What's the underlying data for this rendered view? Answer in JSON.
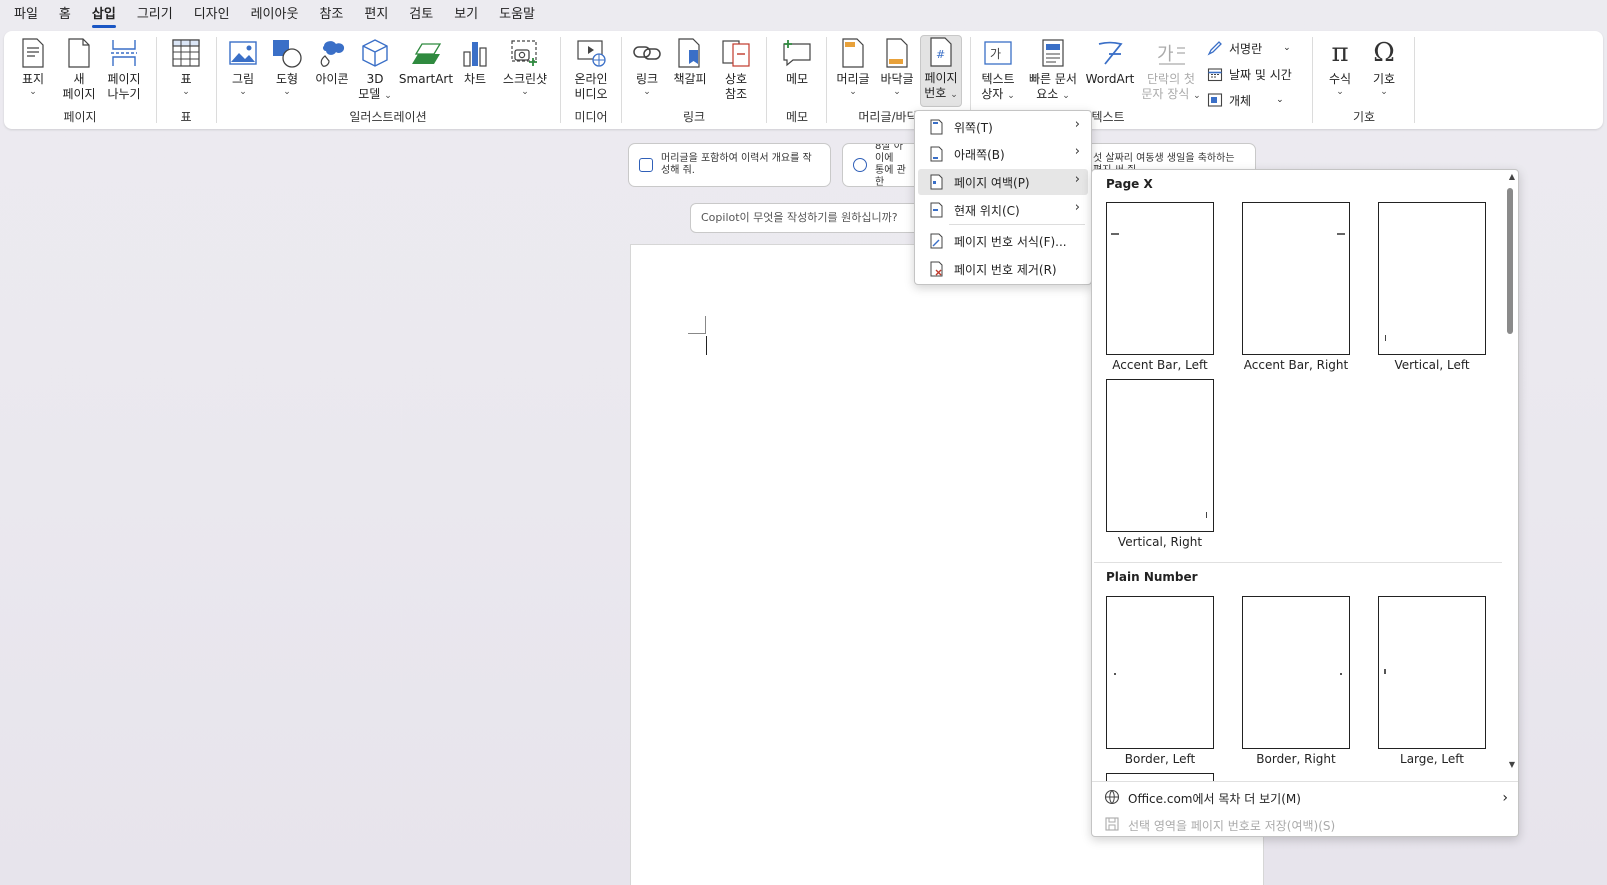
{
  "menu": {
    "items": [
      "파일",
      "홈",
      "삽입",
      "그리기",
      "디자인",
      "레이아웃",
      "참조",
      "편지",
      "검토",
      "보기",
      "도움말"
    ],
    "active_index": 2
  },
  "ribbon": {
    "groups": {
      "pages": "페이지",
      "table": "표",
      "illustrations": "일러스트레이션",
      "media": "미디어",
      "links": "링크",
      "comments": "메모",
      "header_footer": "머리글/바닥",
      "text": "텍스트",
      "symbols": "기호"
    },
    "buttons": {
      "cover": "표지",
      "new_page_1": "새",
      "new_page_2": "페이지",
      "page_break_1": "페이지",
      "page_break_2": "나누기",
      "table": "표",
      "pictures": "그림",
      "shapes": "도형",
      "icons": "아이콘",
      "model3d_1": "3D",
      "model3d_2": "모델",
      "smartart": "SmartArt",
      "chart": "차트",
      "screenshot": "스크린샷",
      "online_video_1": "온라인",
      "online_video_2": "비디오",
      "link": "링크",
      "bookmark": "책갈피",
      "crossref_1": "상호",
      "crossref_2": "참조",
      "comment": "메모",
      "header": "머리글",
      "footer": "바닥글",
      "page_number_1": "페이지",
      "page_number_2": "번호",
      "textbox_1": "텍스트",
      "textbox_2": "상자",
      "quickparts_1": "빠른 문서",
      "quickparts_2": "요소",
      "wordart": "WordArt",
      "dropcap_1": "단락의 첫",
      "dropcap_2": "문자 장식",
      "signature": "서명란",
      "datetime": "날짜 및 시간",
      "object": "개체",
      "equation": "수식",
      "symbol": "기호"
    }
  },
  "suggestions": {
    "s1": "머리글을 포함하여 이력서 개요를 작성해 줘.",
    "s2_a": "8살 아이에",
    "s2_b": "통에 관한",
    "s3_a": "섯 살짜리 여동생 생일을 축하하는",
    "s3_b": "편지 써 줘"
  },
  "copilot_placeholder": "Copilot이 무엇을 작성하기를 원하십니까?",
  "page_number_menu": {
    "items": [
      {
        "label": "위쪽(T)",
        "submenu": true
      },
      {
        "label": "아래쪽(B)",
        "submenu": true
      },
      {
        "label": "페이지 여백(P)",
        "submenu": true,
        "highlighted": true
      },
      {
        "label": "현재 위치(C)",
        "submenu": true
      },
      {
        "label": "페이지 번호 서식(F)...",
        "submenu": false
      },
      {
        "label": "페이지 번호 제거(R)",
        "submenu": false
      }
    ]
  },
  "gallery": {
    "section1": "Page X",
    "section2": "Plain Number",
    "items1": [
      "Accent Bar, Left",
      "Accent Bar, Right",
      "Vertical, Left",
      "Vertical, Right"
    ],
    "items2": [
      "Border, Left",
      "Border, Right",
      "Large, Left"
    ],
    "more": "Office.com에서 목차 더 보기(M)",
    "save": "선택 영역을 페이지 번호로 저장(여백)(S)"
  }
}
